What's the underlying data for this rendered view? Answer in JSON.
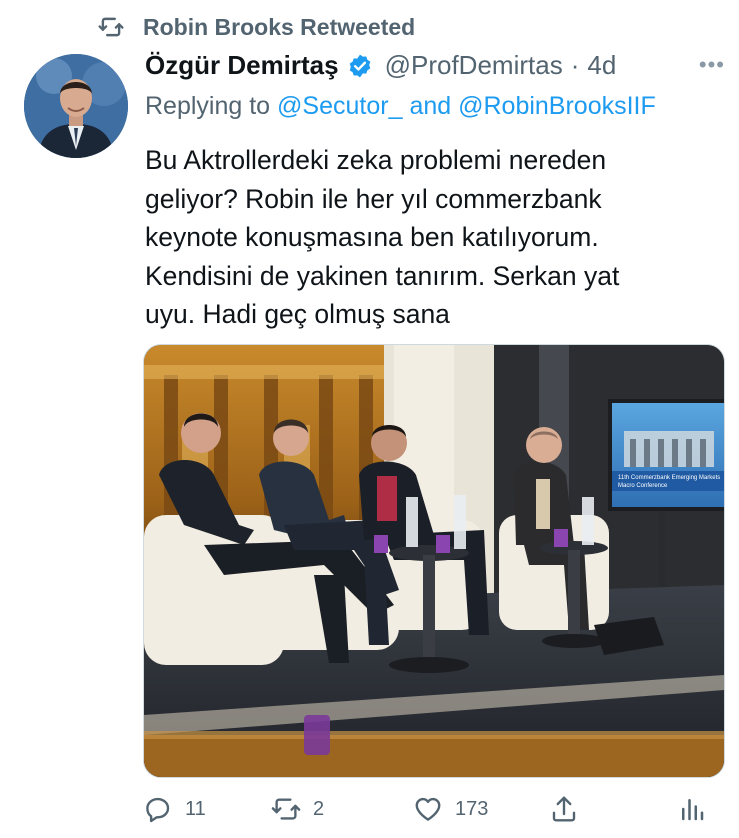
{
  "retweet": {
    "label": "Robin Brooks Retweeted"
  },
  "tweet": {
    "author_name": "Özgür Demirtaş",
    "handle": "@ProfDemirtas",
    "separator": "·",
    "time": "4d",
    "more": "•••",
    "replying_prefix": "Replying to",
    "replying_user_1": "@Secutor_",
    "replying_and": "and",
    "replying_user_2": "@RobinBrooksIIF",
    "text_lines": [
      "Bu Aktrollerdeki zeka problemi nereden",
      "geliyor? Robin ile her yıl commerzbank",
      "keynote konuşmasına ben katılıyorum.",
      "Kendisini de yakinen tanırım. Serkan yat",
      "uyu. Hadi geç olmuş sana"
    ]
  },
  "media": {
    "screen_title_1": "11th Commerzbank Emerging Markets",
    "screen_title_2": "Macro Conference"
  },
  "actions": {
    "replies": "11",
    "retweets": "2",
    "likes": "173"
  },
  "colors": {
    "accent": "#1d9bf0",
    "secondary_text": "#536471",
    "verified": "#1d9bf0"
  },
  "icons": [
    "retweet-icon",
    "verified-badge-icon",
    "more-icon",
    "reply-icon",
    "like-icon",
    "share-icon",
    "analytics-icon"
  ]
}
